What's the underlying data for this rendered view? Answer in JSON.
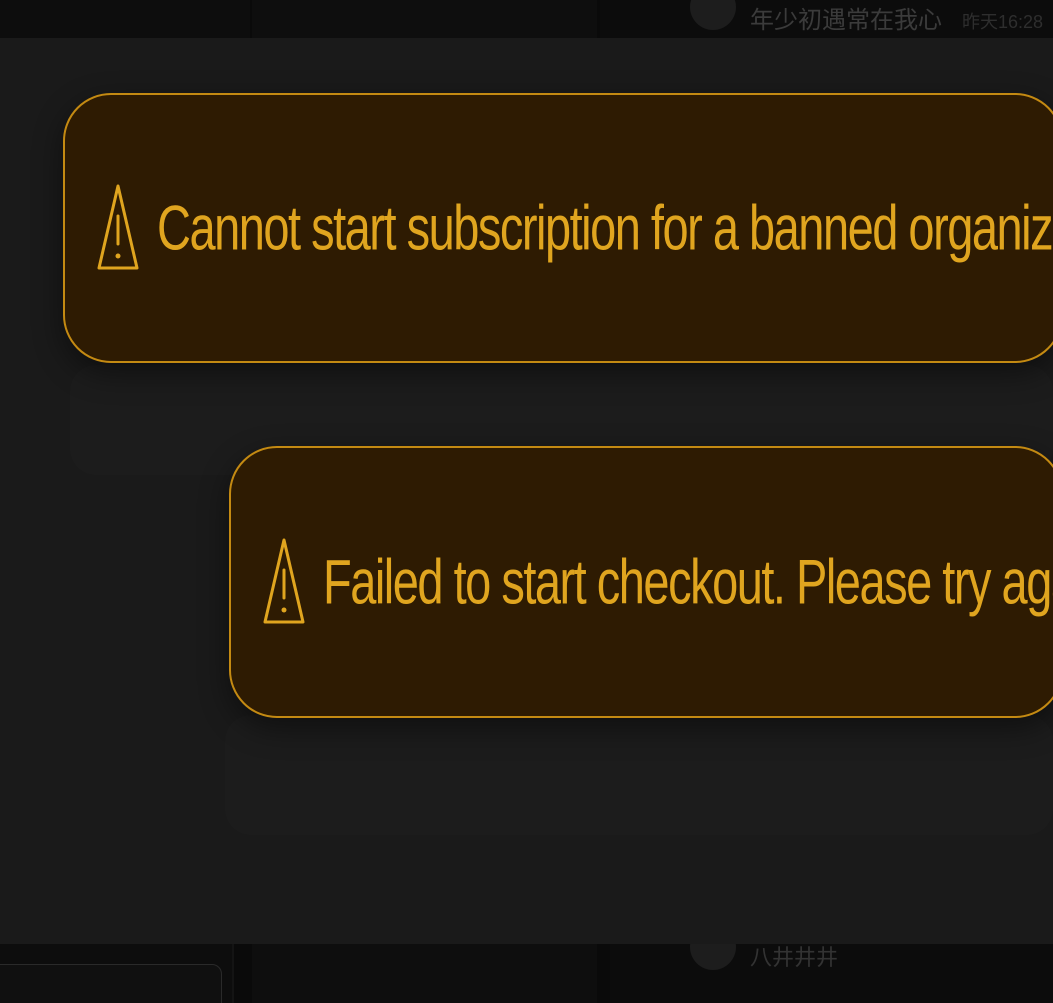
{
  "background_app": {
    "top_name": "年少初遇常在我心",
    "top_time": "昨天16:28",
    "bottom_name": "八井井井"
  },
  "toasts": [
    {
      "message": "Cannot start subscription for a banned organization",
      "icon": "warning-triangle-icon",
      "close_icon": "close-icon"
    },
    {
      "message": "Failed to start checkout. Please try again.",
      "icon": "warning-triangle-icon",
      "close_icon": "close-icon"
    }
  ],
  "colors": {
    "toast_background": "#2e1b02",
    "toast_border": "#c48a12",
    "toast_text": "#e0a51f",
    "overlay": "#1a1a1a"
  }
}
